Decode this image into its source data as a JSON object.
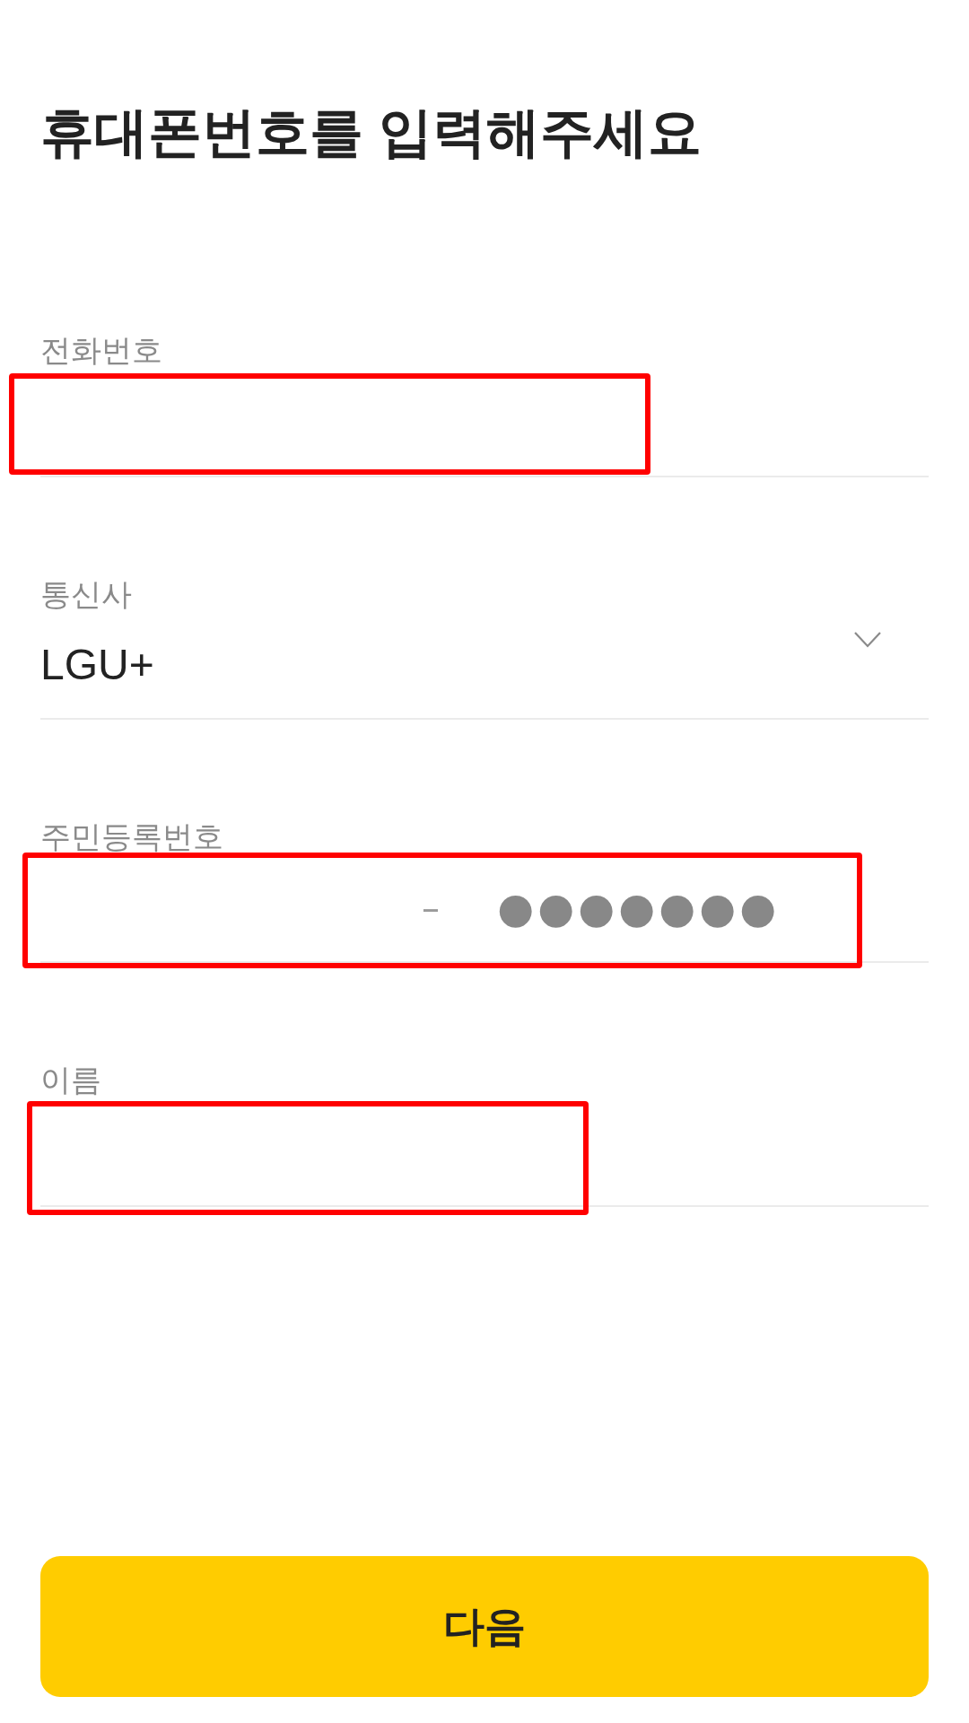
{
  "title": "휴대폰번호를 입력해주세요",
  "fields": [
    {
      "kind": "text",
      "label": "전화번호",
      "marked": true
    },
    {
      "kind": "select",
      "label": "통신사",
      "value": "LGU+",
      "marked": false
    },
    {
      "kind": "resident",
      "label": "주민등록번호",
      "separator": "–",
      "masked": "●●●●●●●",
      "marked": true
    },
    {
      "kind": "text",
      "label": "이름",
      "marked": true
    }
  ],
  "button": {
    "label": "다음"
  }
}
